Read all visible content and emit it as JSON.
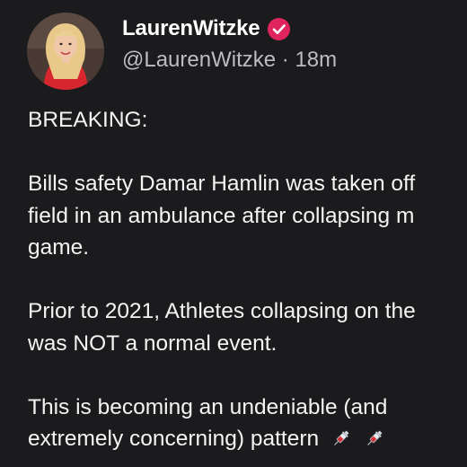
{
  "post": {
    "display_name": "LaurenWitzke",
    "handle": "@LaurenWitzke",
    "separator": "·",
    "time_ago": "18m",
    "paragraphs": {
      "p1": "BREAKING:",
      "p2_l1": "Bills safety Damar Hamlin was taken off",
      "p2_l2": "field in an ambulance after collapsing m",
      "p2_l3": "game.",
      "p3_l1": "Prior to 2021, Athletes collapsing on the",
      "p3_l2": "was NOT a normal event.",
      "p4_l1": "This is becoming an undeniable (and",
      "p4_l2": "extremely concerning) pattern"
    },
    "emoji": [
      "syringe-icon",
      "syringe-icon"
    ]
  },
  "colors": {
    "background": "#1b1b1d",
    "verified_badge": "#e0245e",
    "text": "#f4f4f4",
    "secondary_text": "#bdbdbf"
  }
}
